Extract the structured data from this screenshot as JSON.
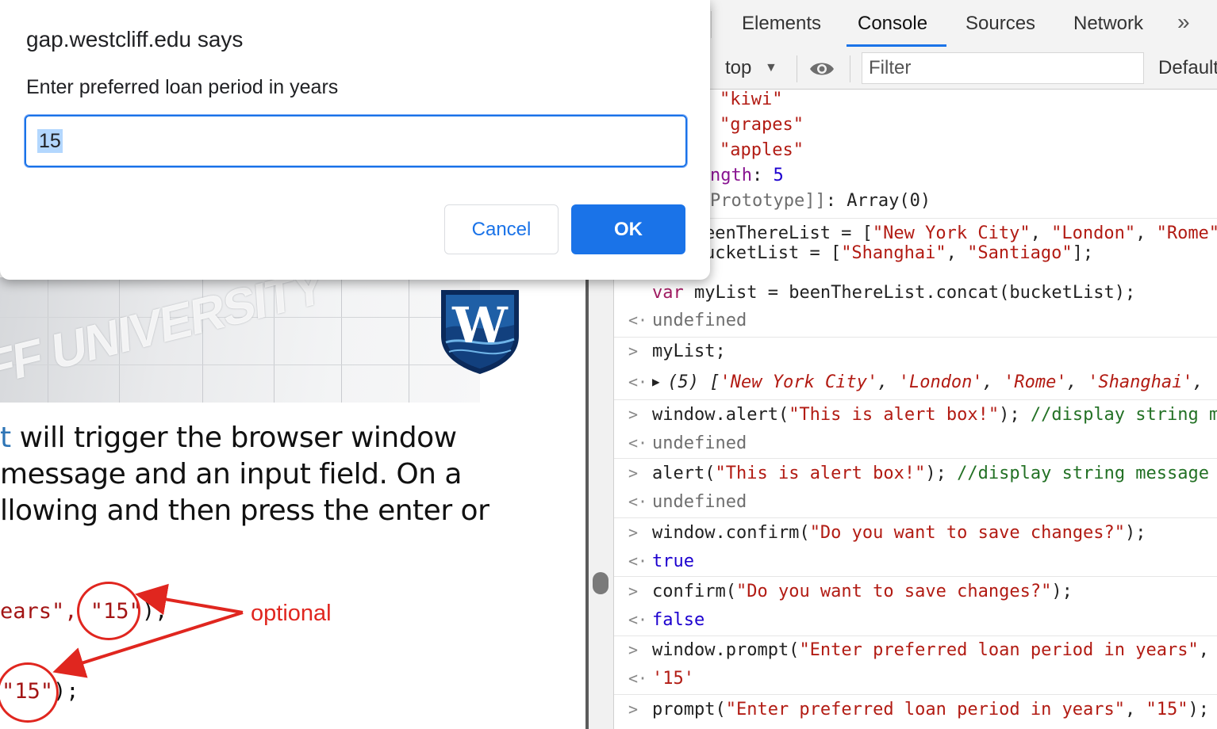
{
  "dialog": {
    "title": "gap.westcliff.edu says",
    "message": "Enter preferred loan period in years",
    "input_value": "15",
    "cancel_label": "Cancel",
    "ok_label": "OK"
  },
  "slide": {
    "line1_blue": "t",
    "line1_rest": " will trigger the browser window",
    "line2": " message and an input field. On a",
    "line3": "llowing and then press the enter or",
    "code1_pre": "ears\", ",
    "code1_val": "\"15\"",
    "code1_post": ");",
    "code2_val": "\"15\"",
    "code2_post": ");",
    "annotation": "optional",
    "logo_letter": "W",
    "banner_text": "IFF UNIVERSITY"
  },
  "devtools": {
    "tabs": [
      "Elements",
      "Console",
      "Sources",
      "Network"
    ],
    "more_tabs": "»",
    "context": "top",
    "filter_placeholder": "Filter",
    "levels": "Default"
  },
  "console": {
    "array_items": [
      "\"kiwi\"",
      "\"grapes\"",
      "\"apples\""
    ],
    "length_key": "ngth",
    "length_sep": ": ",
    "length_val": "5",
    "proto_key": "Prototype]]",
    "proto_val": ": Array(0)",
    "input1_a_pre": "eenThereList = [",
    "input1_a_s1": "\"New York City\"",
    "input1_a_c1": ", ",
    "input1_a_s2": "\"London\"",
    "input1_a_c2": ", ",
    "input1_a_s3": "\"Rome\"",
    "input1_b_pre": "ucketList = [",
    "input1_b_s1": "\"Shanghai\"",
    "input1_b_c1": ", ",
    "input1_b_s2": "\"Santiago\"",
    "input1_b_post": "];",
    "input1_c_kw": "var",
    "input1_c_rest": " myList = beenThereList.concat(bucketList);",
    "undefined": "undefined",
    "input2": "myList;",
    "output2_count": "(5)",
    "output2_open": " [",
    "output2_s1": "'New York City'",
    "output2_s2": "'London'",
    "output2_s3": "'Rome'",
    "output2_s4": "'Shanghai'",
    "comma": ", ",
    "input3_pre": "window.alert(",
    "input3_str": "\"This is alert box!\"",
    "input3_post": "); ",
    "input3_cmt": "//display string m",
    "input4_pre": "alert(",
    "input4_str": "\"This is alert box!\"",
    "input4_post": "); ",
    "input4_cmt": "//display string message",
    "input5_pre": "window.confirm(",
    "input5_str": "\"Do you want to save changes?\"",
    "input5_post": ");",
    "output5": "true",
    "input6_pre": "confirm(",
    "input6_str": "\"Do you want to save changes?\"",
    "input6_post": ");",
    "output6": "false",
    "input7_pre": "window.prompt(",
    "input7_str": "\"Enter preferred loan period in years\"",
    "input7_post": ",",
    "output7": "'15'",
    "input8_pre": "prompt(",
    "input8_str1": "\"Enter preferred loan period in years\"",
    "input8_mid": ", ",
    "input8_str2": "\"15\"",
    "input8_post": ");"
  },
  "colors": {
    "accent": "#1a73e8",
    "annotation_red": "#e0261f",
    "string_red": "#b21b13",
    "comment_green": "#237125",
    "keyword": "#a11c62"
  }
}
